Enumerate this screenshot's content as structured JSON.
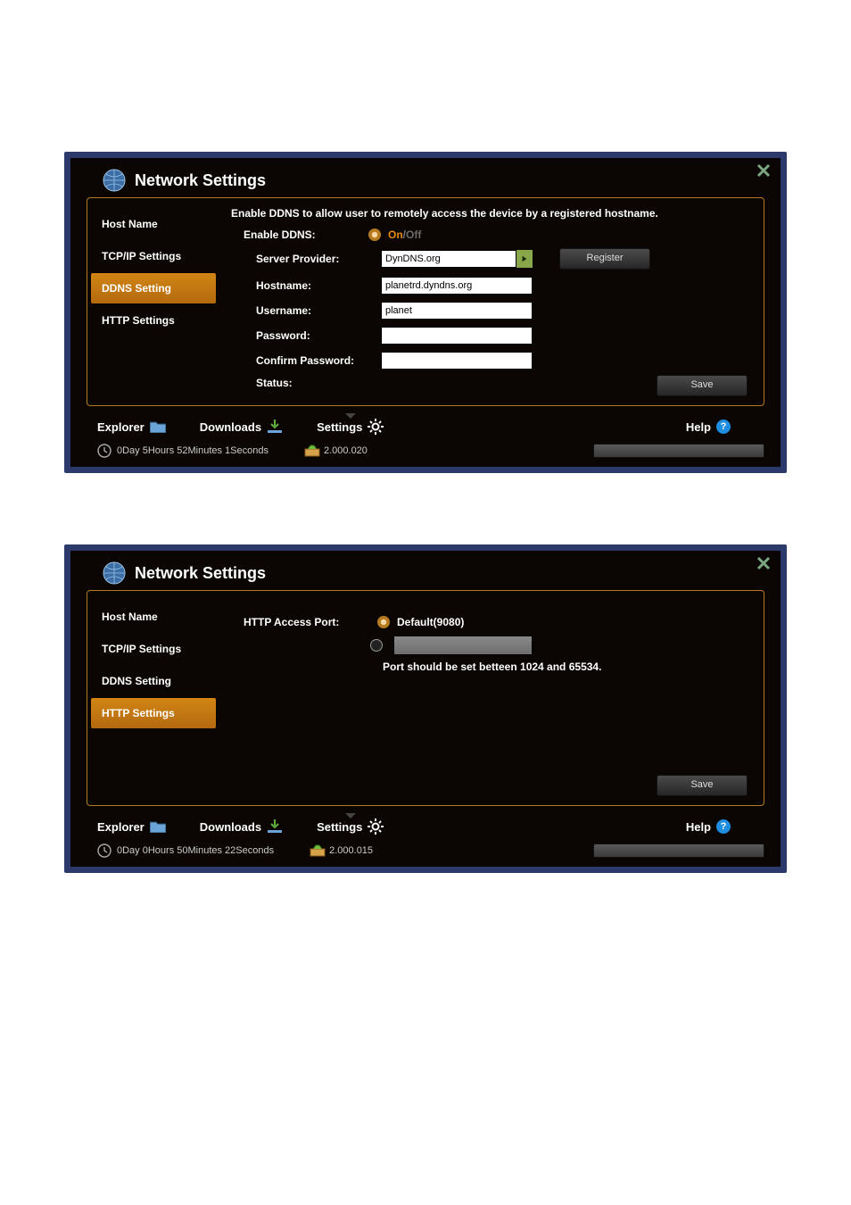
{
  "panel1": {
    "title": "Network Settings",
    "nav": {
      "host_name": "Host Name",
      "tcpip": "TCP/IP Settings",
      "ddns": "DDNS Setting",
      "http": "HTTP Settings"
    },
    "ddns": {
      "desc": "Enable DDNS to allow user to remotely access the device by a registered hostname.",
      "enable_label": "Enable DDNS:",
      "on_label": "On",
      "off_label": "Off",
      "server_provider_label": "Server Provider:",
      "server_provider_value": "DynDNS.org",
      "register_label": "Register",
      "hostname_label": "Hostname:",
      "hostname_value": "planetrd.dyndns.org",
      "username_label": "Username:",
      "username_value": "planet",
      "password_label": "Password:",
      "password_value": "",
      "confirm_password_label": "Confirm Password:",
      "confirm_password_value": "",
      "status_label": "Status:",
      "save_label": "Save"
    },
    "bottombar": {
      "explorer": "Explorer",
      "downloads": "Downloads",
      "settings": "Settings",
      "help": "Help"
    },
    "status": {
      "uptime": "0Day 5Hours 52Minutes 1Seconds",
      "version": "2.000.020"
    }
  },
  "panel2": {
    "title": "Network Settings",
    "nav": {
      "host_name": "Host Name",
      "tcpip": "TCP/IP Settings",
      "ddns": "DDNS Setting",
      "http": "HTTP Settings"
    },
    "http": {
      "port_label": "HTTP Access Port:",
      "default_label": "Default(9080)",
      "custom_value": "",
      "hint": "Port should be set betteen 1024 and 65534.",
      "save_label": "Save"
    },
    "bottombar": {
      "explorer": "Explorer",
      "downloads": "Downloads",
      "settings": "Settings",
      "help": "Help"
    },
    "status": {
      "uptime": "0Day 0Hours 50Minutes 22Seconds",
      "version": "2.000.015"
    }
  }
}
